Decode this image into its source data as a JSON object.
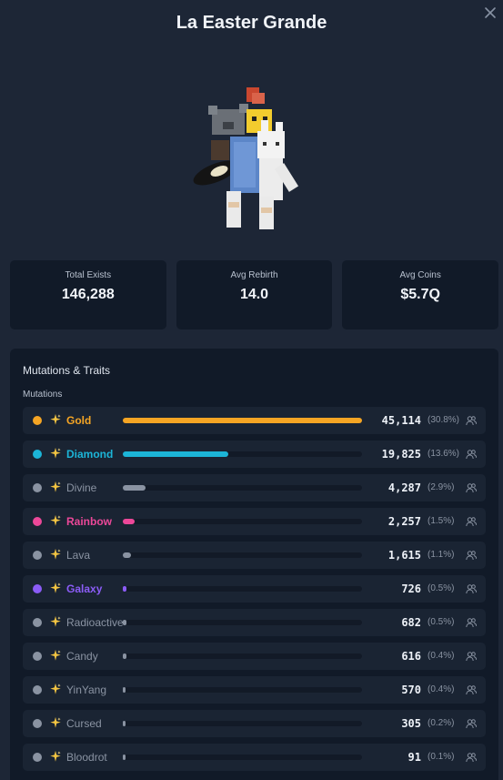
{
  "modal": {
    "title": "La Easter Grande"
  },
  "stats": [
    {
      "label": "Total Exists",
      "value": "146,288"
    },
    {
      "label": "Avg Rebirth",
      "value": "14.0"
    },
    {
      "label": "Avg Coins",
      "value": "$5.7Q"
    }
  ],
  "traits": {
    "title": "Mutations & Traits",
    "section_label": "Mutations",
    "mutations": [
      {
        "name": "Gold",
        "count": "45,114",
        "percent": "(30.8%)",
        "color": "#f5a524",
        "named_color": "#f5a524",
        "bar_fraction": 1.0
      },
      {
        "name": "Diamond",
        "count": "19,825",
        "percent": "(13.6%)",
        "color": "#1cb5d8",
        "named_color": "#1cb5d8",
        "bar_fraction": 0.44
      },
      {
        "name": "Divine",
        "count": "4,287",
        "percent": "(2.9%)",
        "color": "#8a93a2",
        "named_color": "#8a93a2",
        "bar_fraction": 0.095
      },
      {
        "name": "Rainbow",
        "count": "2,257",
        "percent": "(1.5%)",
        "color": "#ec4899",
        "named_color": "#ec4899",
        "bar_fraction": 0.05
      },
      {
        "name": "Lava",
        "count": "1,615",
        "percent": "(1.1%)",
        "color": "#8a93a2",
        "named_color": "#8a93a2",
        "bar_fraction": 0.036
      },
      {
        "name": "Galaxy",
        "count": "726",
        "percent": "(0.5%)",
        "color": "#8b5cf6",
        "named_color": "#8b5cf6",
        "bar_fraction": 0.016
      },
      {
        "name": "Radioactive",
        "count": "682",
        "percent": "(0.5%)",
        "color": "#8a93a2",
        "named_color": "#8a93a2",
        "bar_fraction": 0.015
      },
      {
        "name": "Candy",
        "count": "616",
        "percent": "(0.4%)",
        "color": "#8a93a2",
        "named_color": "#8a93a2",
        "bar_fraction": 0.014
      },
      {
        "name": "YinYang",
        "count": "570",
        "percent": "(0.4%)",
        "color": "#8a93a2",
        "named_color": "#8a93a2",
        "bar_fraction": 0.013
      },
      {
        "name": "Cursed",
        "count": "305",
        "percent": "(0.2%)",
        "color": "#8a93a2",
        "named_color": "#8a93a2",
        "bar_fraction": 0.007
      },
      {
        "name": "Bloodrot",
        "count": "91",
        "percent": "(0.1%)",
        "color": "#8a93a2",
        "named_color": "#8a93a2",
        "bar_fraction": 0.002
      }
    ]
  },
  "icons": {
    "close": "close-icon",
    "sparkle": "sparkle-icon",
    "users": "users-icon"
  }
}
